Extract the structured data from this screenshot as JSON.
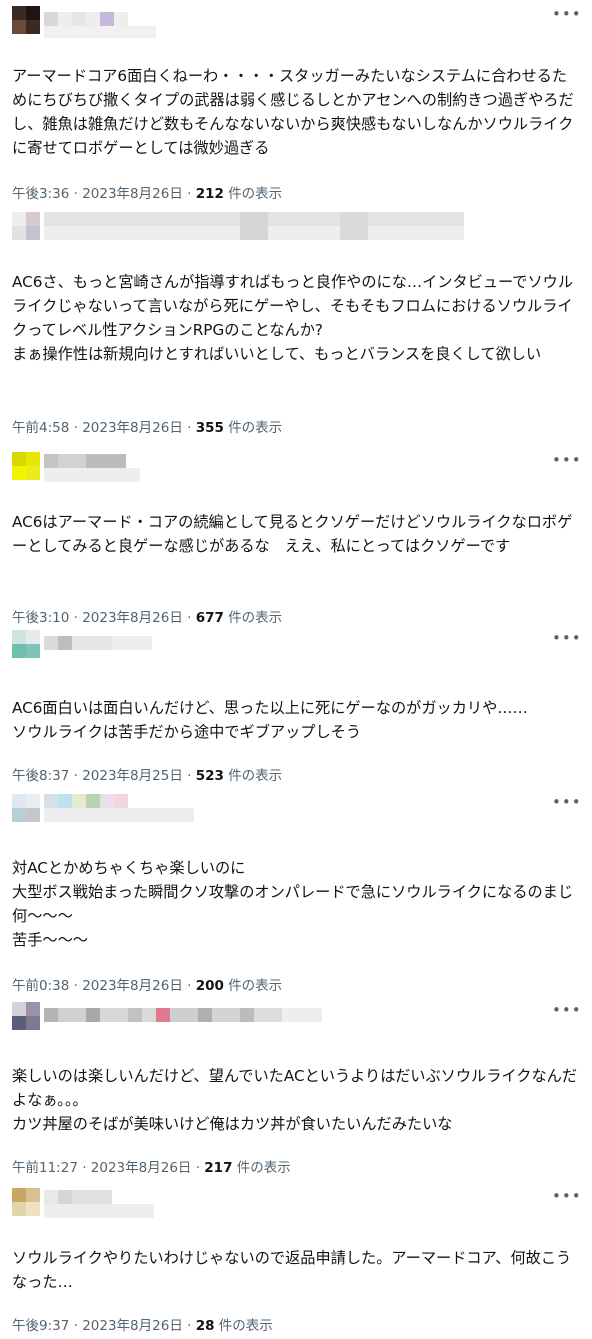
{
  "posts": [
    {
      "text": "アーマードコア6面白くねーわ・・・・スタッガーみたいなシステムに合わせるためにちびちび撒くタイプの武器は弱く感じるしとかアセンへの制約きつ過ぎやろだし、雑魚は雑魚だけど数もそんなないないから爽快感もないしなんかソウルライクに寄せてロボゲーとしては微妙過ぎる",
      "time": "午後3:36",
      "date": "2023年8月26日",
      "views": "212",
      "views_suffix": "件の表示"
    },
    {
      "text": "AC6さ、もっと宮崎さんが指導すればもっと良作やのにな…インタビューでソウルライクじゃないって言いながら死にゲーやし、そもそもフロムにおけるソウルライクってレベル性アクションRPGのことなんか?\nまぁ操作性は新規向けとすればいいとして、もっとバランスを良くして欲しい",
      "time": "午前4:58",
      "date": "2023年8月26日",
      "views": "355",
      "views_suffix": "件の表示"
    },
    {
      "text": "AC6はアーマード・コアの続編として見るとクソゲーだけどソウルライクなロボゲーとしてみると良ゲーな感じがあるな　ええ、私にとってはクソゲーです",
      "time": "午後3:10",
      "date": "2023年8月26日",
      "views": "677",
      "views_suffix": "件の表示"
    },
    {
      "text": "AC6面白いは面白いんだけど、思った以上に死にゲーなのがガッカリや……\nソウルライクは苦手だから途中でギブアップしそう",
      "time": "午後8:37",
      "date": "2023年8月25日",
      "views": "523",
      "views_suffix": "件の表示"
    },
    {
      "text": "対ACとかめちゃくちゃ楽しいのに\n大型ボス戦始まった瞬間クソ攻撃のオンパレードで急にソウルライクになるのまじ何〜〜〜\n苦手〜〜〜",
      "time": "午前0:38",
      "date": "2023年8月26日",
      "views": "200",
      "views_suffix": "件の表示"
    },
    {
      "text": "楽しいのは楽しいんだけど、望んでいたACというよりはだいぶソウルライクなんだよなぁ。。。\nカツ丼屋のそばが美味いけど俺はカツ丼が食いたいんだみたいな",
      "time": "午前11:27",
      "date": "2023年8月26日",
      "views": "217",
      "views_suffix": "件の表示"
    },
    {
      "text": "ソウルライクやりたいわけじゃないので返品申請した。アーマードコア、何故こうなった…",
      "time": "午後9:37",
      "date": "2023年8月26日",
      "views": "28",
      "views_suffix": "件の表示"
    }
  ],
  "ui": {
    "more_icon": "more-dots-icon",
    "separator": " · "
  },
  "colors": {
    "text": "#0f1419",
    "meta": "#536471",
    "background": "#ffffff"
  }
}
